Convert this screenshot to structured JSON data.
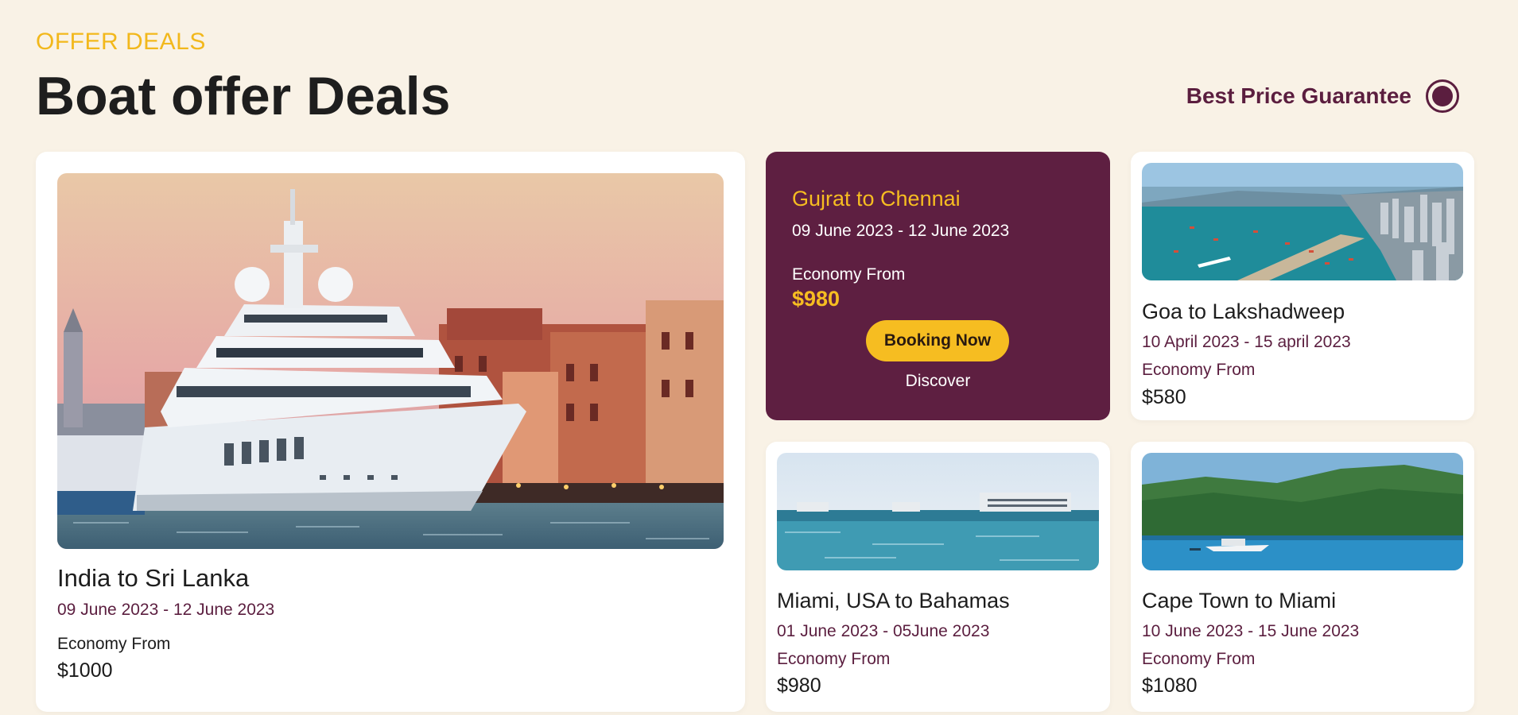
{
  "header": {
    "eyebrow": "OFFER DEALS",
    "title": "Boat offer Deals",
    "guarantee": "Best Price Guarantee"
  },
  "featured": {
    "title": "India to Sri Lanka",
    "dates": "09 June 2023 - 12 June 2023",
    "economy_label": "Economy From",
    "price": "$1000",
    "image": "yacht-harbor-photo"
  },
  "promo": {
    "title": "Gujrat to Chennai",
    "dates": "09 June 2023 - 12 June 2023",
    "economy_label": "Economy From",
    "price": "$980",
    "button_label": "Booking Now",
    "link_label": "Discover"
  },
  "deals": [
    {
      "title": "Goa to Lakshadweep",
      "dates": "10 April 2023 - 15 april 2023",
      "economy_label": "Economy From",
      "price": "$580",
      "image": "harbor-city-photo"
    },
    {
      "title": "Miami, USA to Bahamas",
      "dates": "01 June 2023 - 05June 2023",
      "economy_label": "Economy From",
      "price": "$980",
      "image": "sea-ships-photo"
    },
    {
      "title": "Cape Town to Miami",
      "dates": "10 June 2023 - 15 June 2023",
      "economy_label": "Economy From",
      "price": "$1080",
      "image": "island-boat-photo"
    }
  ],
  "colors": {
    "background": "#f9f2e6",
    "accent_yellow": "#f6bd21",
    "brand_plum": "#5e1f41"
  }
}
